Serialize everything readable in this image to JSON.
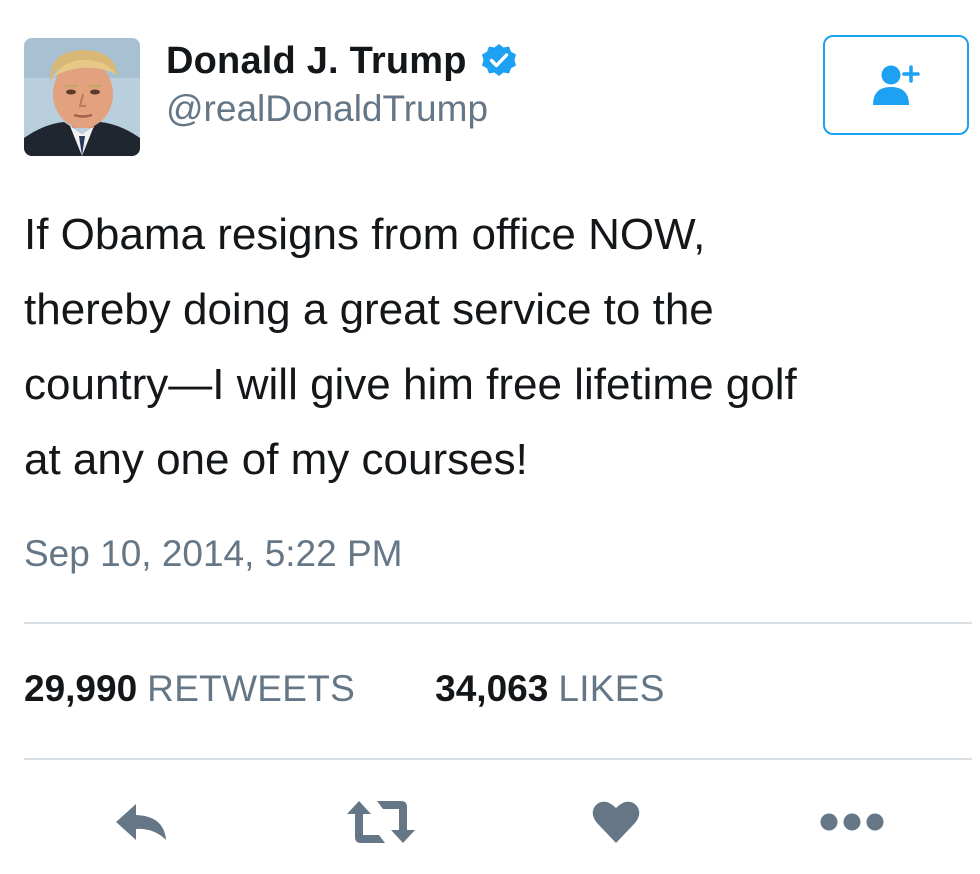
{
  "user": {
    "display_name": "Donald J. Trump",
    "handle": "@realDonaldTrump",
    "verified": true,
    "avatar_icon": "profile-photo"
  },
  "follow_button": {
    "icon": "add-user-icon"
  },
  "tweet": {
    "text_lines": [
      "If Obama resigns from office NOW,",
      "thereby doing a great service to the",
      "country—I will give him free lifetime golf",
      "at any one of my courses!"
    ],
    "timestamp": "Sep 10, 2014, 5:22 PM"
  },
  "stats": {
    "retweets_count": "29,990",
    "retweets_label": "RETWEETS",
    "likes_count": "34,063",
    "likes_label": "LIKES"
  },
  "actions": [
    {
      "name": "reply",
      "icon": "reply-icon"
    },
    {
      "name": "retweet",
      "icon": "retweet-icon"
    },
    {
      "name": "like",
      "icon": "heart-icon"
    },
    {
      "name": "more",
      "icon": "more-dots-icon"
    }
  ],
  "colors": {
    "accent": "#1da1f2",
    "text_primary": "#14171a",
    "text_secondary": "#657786",
    "icon_gray": "#657786",
    "divider": "#d8e0e6"
  }
}
